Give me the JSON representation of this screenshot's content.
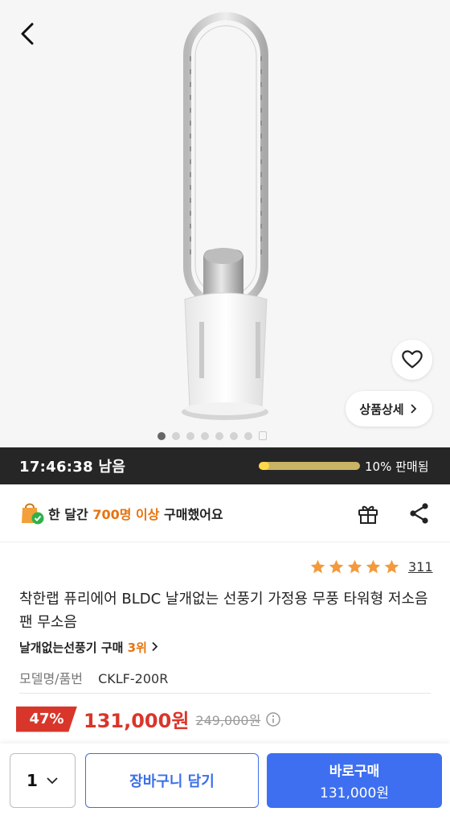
{
  "hero": {
    "detail_button": "상품상세",
    "image_count": 7,
    "active_image": 1
  },
  "timer": {
    "remaining": "17:46:38",
    "remaining_suffix": "남음",
    "sold_percent": 10,
    "sold_label": "10% 판매됨",
    "bar_color": "#ffd84a"
  },
  "purchase_info": {
    "prefix": "한 달간",
    "highlight": "700명 이상",
    "suffix": "구매했어요"
  },
  "product": {
    "rating_stars": 5,
    "review_count": "311",
    "title": "착한랩 퓨리에어 BLDC 날개없는 선풍기 가정용 무풍 타워형 저소음 팬 무소음",
    "ranking_prefix": "날개없는선풍기 구매",
    "ranking_value": "3위",
    "model_label": "모델명/품번",
    "model_value": "CKLF-200R"
  },
  "price": {
    "discount": "47%",
    "sale_price": "131,000원",
    "original_price": "249,000원",
    "accent_color": "#d9362b"
  },
  "actions": {
    "quantity": "1",
    "cart_label": "장바구니 담기",
    "buy_label": "바로구매",
    "buy_amount": "131,000원",
    "primary_color": "#3d6ff0"
  },
  "icons": [
    "back-arrow-icon",
    "heart-icon",
    "chevron-right-icon",
    "shopping-bag-check-icon",
    "gift-icon",
    "share-icon",
    "star-icon",
    "info-icon",
    "chevron-down-icon"
  ]
}
